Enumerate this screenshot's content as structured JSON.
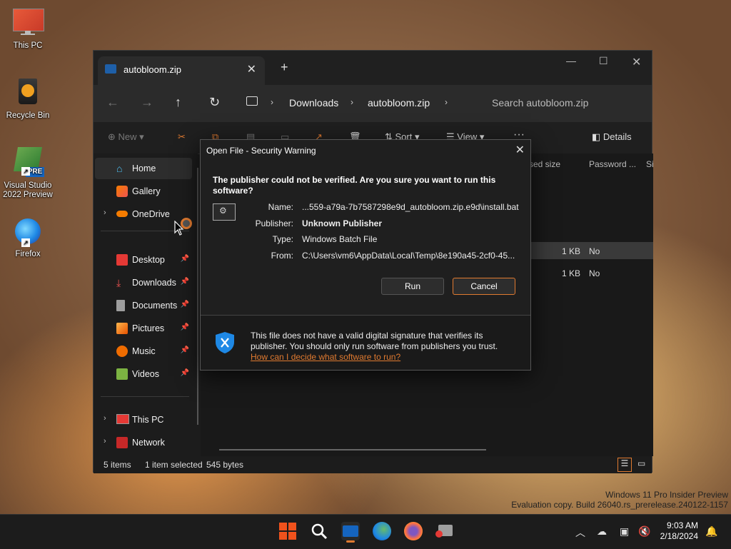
{
  "desktop": {
    "icons": [
      {
        "label": "This PC"
      },
      {
        "label": "Recycle Bin"
      },
      {
        "label": "Visual Studio 2022 Preview",
        "badge": "PRE"
      },
      {
        "label": "Firefox"
      }
    ]
  },
  "explorer": {
    "tab_title": "autobloom.zip",
    "breadcrumb": [
      "Downloads",
      "autobloom.zip"
    ],
    "search_placeholder": "Search autobloom.zip",
    "toolbar": {
      "new": "New",
      "sort": "Sort",
      "view": "View",
      "details": "Details"
    },
    "sidebar": {
      "home": "Home",
      "gallery": "Gallery",
      "onedrive": "OneDrive",
      "desktop": "Desktop",
      "downloads": "Downloads",
      "documents": "Documents",
      "pictures": "Pictures",
      "music": "Music",
      "videos": "Videos",
      "this_pc": "This PC",
      "network": "Network"
    },
    "columns": {
      "compressed_size_partial": "sed size",
      "password": "Password ...",
      "size_partial": "Si"
    },
    "rows": [
      {
        "size": "1 KB",
        "password": "No"
      },
      {
        "size": "1 KB",
        "password": "No"
      }
    ],
    "status": {
      "items": "5 items",
      "selected": "1 item selected",
      "bytes": "545 bytes"
    }
  },
  "dialog": {
    "title": "Open File - Security Warning",
    "question": "The publisher could not be verified.  Are you sure you want to run this software?",
    "fields": {
      "name_label": "Name:",
      "name_value": "...559-a79a-7b7587298e9d_autobloom.zip.e9d\\install.bat",
      "publisher_label": "Publisher:",
      "publisher_value": "Unknown Publisher",
      "type_label": "Type:",
      "type_value": "Windows Batch File",
      "from_label": "From:",
      "from_value": "C:\\Users\\vm6\\AppData\\Local\\Temp\\8e190a45-2cf0-45..."
    },
    "run_label": "Run",
    "cancel_label": "Cancel",
    "warning": "This file does not have a valid digital signature that verifies its publisher.  You should only run software from publishers you trust.",
    "link": "How can I decide what software to run?"
  },
  "watermark": {
    "line1": "Windows 11 Pro Insider Preview",
    "line2": "Evaluation copy. Build 26040.rs_prerelease.240122-1157"
  },
  "taskbar": {
    "time": "9:03 AM",
    "date": "2/18/2024"
  },
  "colors": {
    "accent": "#e07a30",
    "folder": "#f2b632",
    "shield": "#1e88e5"
  }
}
